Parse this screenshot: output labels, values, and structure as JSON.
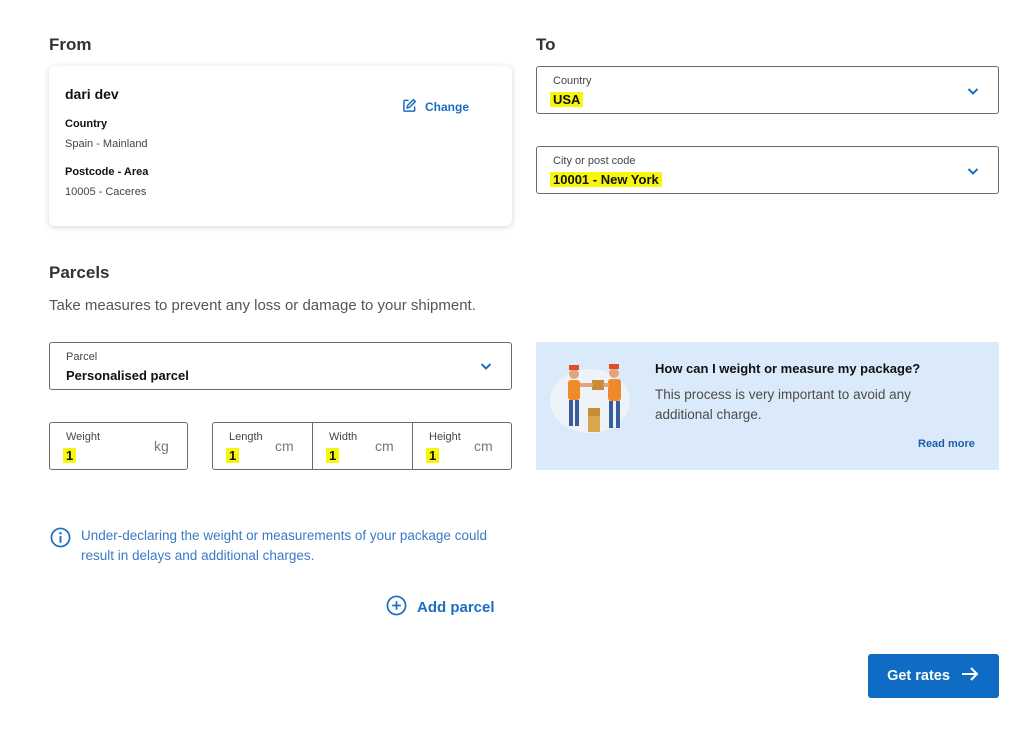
{
  "from": {
    "title": "From",
    "name": "dari dev",
    "country_label": "Country",
    "country_value": "Spain - Mainland",
    "postcode_label": "Postcode - Area",
    "postcode_value": "10005 - Caceres",
    "change_label": "Change"
  },
  "to": {
    "title": "To",
    "country": {
      "label": "Country",
      "value": "USA"
    },
    "city": {
      "label": "City or post code",
      "value": "10001 - New York"
    }
  },
  "parcels": {
    "title": "Parcels",
    "subtitle": "Take measures to prevent any loss or damage to your shipment.",
    "parcel_select": {
      "label": "Parcel",
      "value": "Personalised parcel"
    },
    "weight": {
      "label": "Weight",
      "value": "1",
      "unit": "kg"
    },
    "length": {
      "label": "Length",
      "value": "1",
      "unit": "cm"
    },
    "width": {
      "label": "Width",
      "value": "1",
      "unit": "cm"
    },
    "height": {
      "label": "Height",
      "value": "1",
      "unit": "cm"
    },
    "warning": "Under-declaring the weight or measurements of your package could result in delays and additional charges.",
    "add_parcel": "Add parcel"
  },
  "info": {
    "title": "How can I weight or measure my package?",
    "text": "This process is very important to avoid any additional charge.",
    "read_more": "Read more"
  },
  "actions": {
    "get_rates": "Get rates"
  },
  "colors": {
    "primary": "#0e6cc4",
    "highlight": "#f7f70d",
    "info_bg": "#dbeafa"
  },
  "icons": [
    "edit-icon",
    "chevron-down-icon",
    "info-icon",
    "plus-circle-icon",
    "arrow-right-icon"
  ]
}
